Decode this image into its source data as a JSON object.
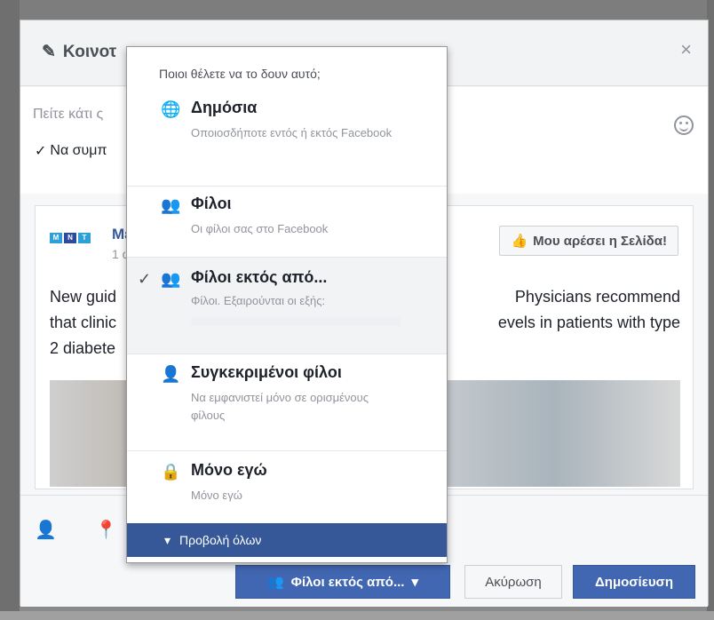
{
  "header": {
    "title": "Κοινοτ",
    "close": "×"
  },
  "composer": {
    "placeholder": "Πείτε κάτι ς",
    "share_check_label": "Να συμπ"
  },
  "post": {
    "page_name": "Με",
    "time": "1 ώ",
    "like_page_label": "Μου αρέσει η Σελίδα!",
    "text_line1_left": "New guid",
    "text_line1_right": "Physicians recommend",
    "text_line2_left": "that clinic",
    "text_line2_right": "evels in patients with type",
    "text_line3_left": "2 diabete",
    "logo": [
      "M",
      "N",
      "T"
    ]
  },
  "privacy_menu": {
    "header": "Ποιοι θέλετε να το δουν αυτό;",
    "options": [
      {
        "title": "Δημόσια",
        "desc": "Οποιοσδήποτε εντός ή εκτός Facebook",
        "icon": "globe-icon"
      },
      {
        "title": "Φίλοι",
        "desc": "Οι φίλοι σας στο Facebook",
        "icon": "friends-icon"
      },
      {
        "title": "Φίλοι εκτός από...",
        "desc": "Φίλοι. Εξαιρούνται οι εξής:",
        "icon": "friends-except-icon",
        "selected": true
      },
      {
        "title": "Συγκεκριμένοι φίλοι",
        "desc": "Να εμφανιστεί μόνο σε ορισμένους φίλους",
        "icon": "person-icon"
      },
      {
        "title": "Μόνο εγώ",
        "desc": "Μόνο εγώ",
        "icon": "lock-icon"
      }
    ],
    "see_all": "Προβολή όλων",
    "check": "✓"
  },
  "footer": {
    "audience_label": "Φίλοι εκτός από...",
    "cancel_label": "Ακύρωση",
    "publish_label": "Δημοσίευση"
  },
  "colors": {
    "accent": "#4267b2",
    "accent_dark": "#365899",
    "muted": "#90949c"
  }
}
